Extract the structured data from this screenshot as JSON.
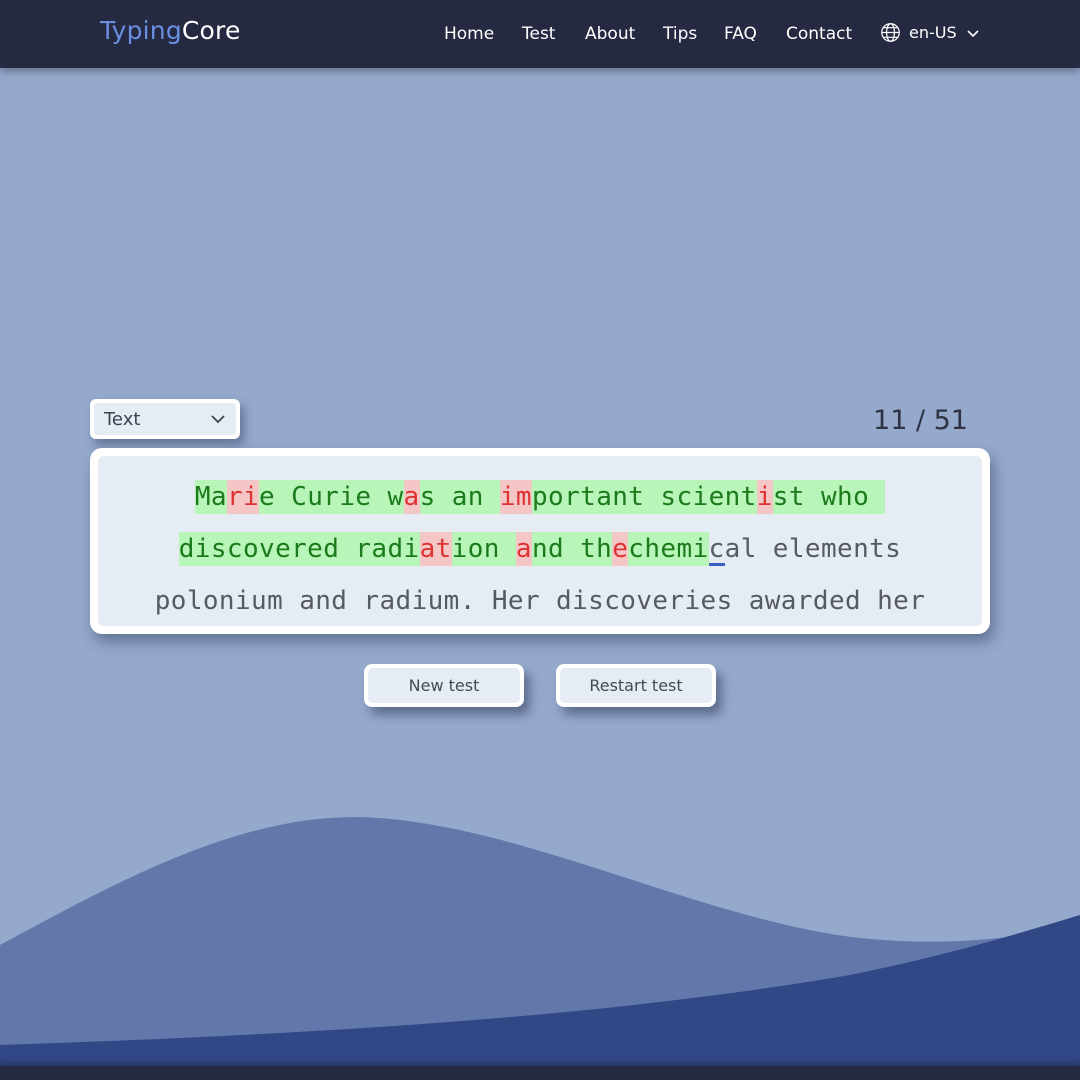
{
  "brand": {
    "part1": "Typing",
    "part2": "Core"
  },
  "nav": {
    "items": [
      "Home",
      "Test",
      "About",
      "Tips",
      "FAQ",
      "Contact"
    ],
    "language": "en-US"
  },
  "test": {
    "mode": "Text",
    "counter": "11 / 51",
    "lines": [
      [
        [
          "Ma",
          "ok"
        ],
        [
          "ri",
          "err"
        ],
        [
          "e Curie w",
          "ok"
        ],
        [
          "a",
          "err"
        ],
        [
          "s an ",
          "ok"
        ],
        [
          "im",
          "err"
        ],
        [
          "portant scient",
          "ok"
        ],
        [
          "i",
          "err"
        ],
        [
          "st who ",
          "ok"
        ]
      ],
      [
        [
          "discovered radi",
          "ok"
        ],
        [
          "at",
          "err"
        ],
        [
          "ion ",
          "ok"
        ],
        [
          "a",
          "err"
        ],
        [
          "nd th",
          "ok"
        ],
        [
          "e",
          "err"
        ],
        [
          "chemi",
          "ok"
        ],
        [
          "c",
          "cur"
        ],
        [
          "al elements",
          ""
        ]
      ],
      [
        [
          "polonium and radium. Her discoveries awarded her",
          ""
        ]
      ]
    ]
  },
  "buttons": {
    "new_test": "New test",
    "restart_test": "Restart test"
  },
  "colors": {
    "background": "#95a9cd",
    "header": "#252a42",
    "correct": "#b8f5b8",
    "incorrect": "#f5c6c6",
    "caret": "#3b5fc0"
  }
}
